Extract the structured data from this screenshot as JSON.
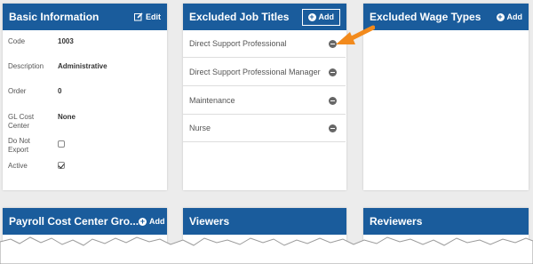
{
  "basic_info": {
    "title": "Basic Information",
    "edit_label": "Edit",
    "fields": {
      "code_label": "Code",
      "code_value": "1003",
      "description_label": "Description",
      "description_value": "Administrative",
      "order_label": "Order",
      "order_value": "0",
      "gl_label": "GL Cost Center",
      "gl_value": "None",
      "do_not_export_label": "Do Not Export",
      "do_not_export_checked": false,
      "active_label": "Active",
      "active_checked": true
    }
  },
  "excluded_job_titles": {
    "title": "Excluded Job Titles",
    "add_label": "Add",
    "items": [
      {
        "label": "Direct Support Professional"
      },
      {
        "label": "Direct Support Professional Manager"
      },
      {
        "label": "Maintenance"
      },
      {
        "label": "Nurse"
      }
    ]
  },
  "excluded_wage_types": {
    "title": "Excluded Wage Types",
    "add_label": "Add"
  },
  "payroll_cost_center": {
    "title": "Payroll Cost Center Gro...",
    "add_label": "Add"
  },
  "viewers": {
    "title": "Viewers"
  },
  "reviewers": {
    "title": "Reviewers"
  },
  "colors": {
    "header": "#1a5c9c",
    "arrow": "#f28a1c",
    "background": "#ececec"
  }
}
